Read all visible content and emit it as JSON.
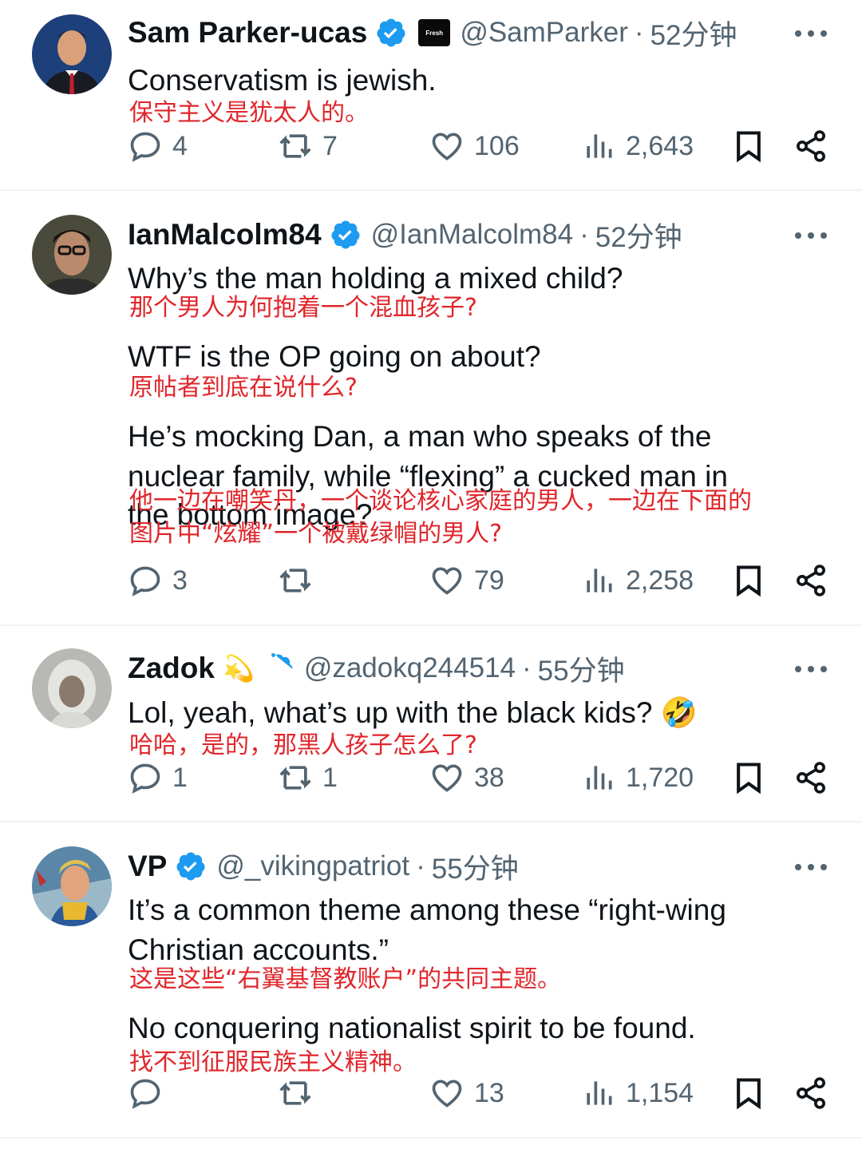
{
  "colors": {
    "handle": "#536471",
    "verified": "#1d9bf0",
    "translation": "#e0262b",
    "text": "#0f1419"
  },
  "tweets": [
    {
      "name": "Sam Parker-ucas",
      "badge_text": "Fresh",
      "handle": "@SamParker",
      "time": "52分钟",
      "lines": [
        "Conservatism is jewish."
      ],
      "translations": [
        "保守主义是犹太人的。"
      ],
      "stats": {
        "replies": "4",
        "retweets": "7",
        "likes": "106",
        "views": "2,643"
      }
    },
    {
      "name": "IanMalcolm84",
      "handle": "@IanMalcolm84",
      "time": "52分钟",
      "lines": [
        "Why’s the man holding a mixed child?",
        "WTF is the OP going on about?",
        "He’s mocking Dan, a man who speaks of the",
        "nuclear family, while “flexing” a cucked man in",
        "the bottom image?"
      ],
      "translations": [
        "那个男人为何抱着一个混血孩子?",
        "原帖者到底在说什么?",
        "他一边在嘲笑丹，一个谈论核心家庭的男人，一边在下面的",
        "图片中“炫耀”一个被戴绿帽的男人?"
      ],
      "stats": {
        "replies": "3",
        "retweets": "",
        "likes": "79",
        "views": "2,258"
      }
    },
    {
      "name": "Zadok",
      "emoji": "💫",
      "handle": "@zadokq244514",
      "time": "55分钟",
      "lines": [
        "Lol, yeah, what’s up with the black kids? 🤣"
      ],
      "translations": [
        "哈哈，是的，那黑人孩子怎么了?"
      ],
      "stats": {
        "replies": "1",
        "retweets": "1",
        "likes": "38",
        "views": "1,720"
      }
    },
    {
      "name": "VP",
      "handle": "@_vikingpatriot",
      "time": "55分钟",
      "lines": [
        "It’s a common theme among these “right-wing",
        "Christian accounts.”",
        "No conquering nationalist spirit to be found."
      ],
      "translations": [
        "这是这些“右翼基督教账户”的共同主题。",
        "找不到征服民族主义精神。"
      ],
      "stats": {
        "replies": "",
        "retweets": "",
        "likes": "13",
        "views": "1,154"
      }
    }
  ],
  "separator": "·"
}
